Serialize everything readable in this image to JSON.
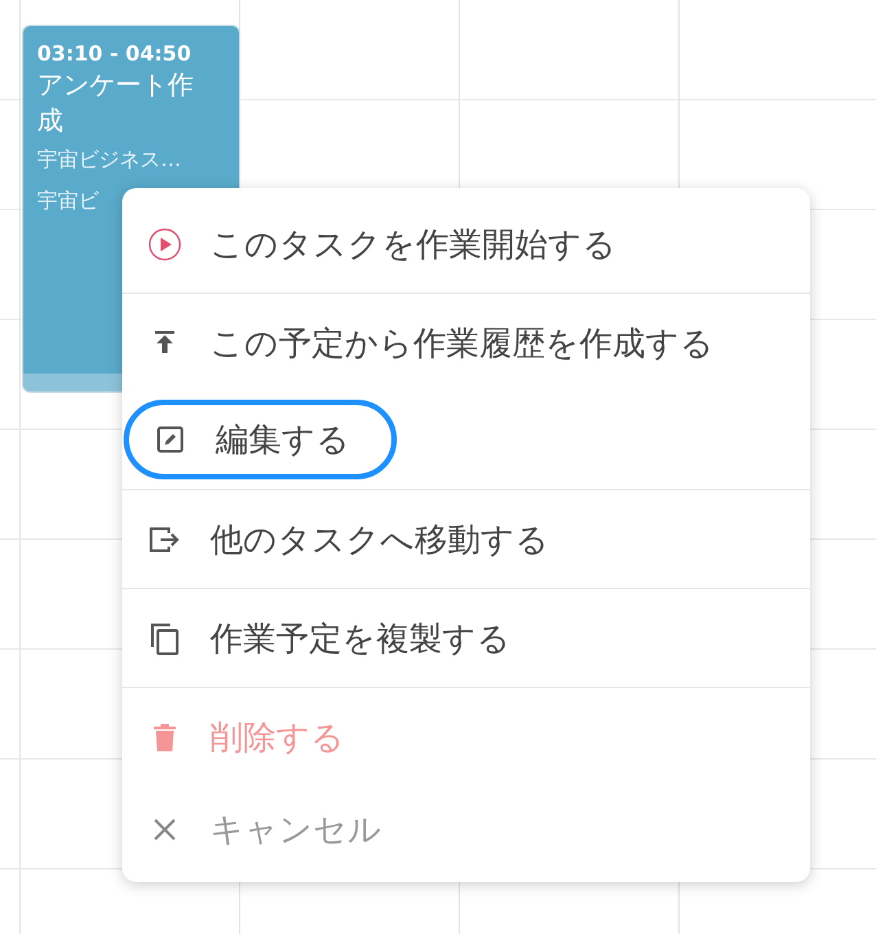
{
  "event": {
    "time": "03:10 - 04:50",
    "title": "アンケート作成",
    "lines": [
      "宇宙ビジネス…",
      "宇宙ビ"
    ]
  },
  "menu": {
    "items": [
      {
        "label": "このタスクを作業開始する",
        "kind": "play",
        "focused": false
      },
      {
        "label": "この予定から作業履歴を作成する",
        "kind": "upload",
        "focused": false
      },
      {
        "label": "編集する",
        "kind": "edit",
        "focused": true
      },
      {
        "label": "他のタスクへ移動する",
        "kind": "move",
        "focused": false
      },
      {
        "label": "作業予定を複製する",
        "kind": "copy",
        "focused": false
      },
      {
        "label": "削除する",
        "kind": "delete",
        "focused": false
      },
      {
        "label": "キャンセル",
        "kind": "cancel",
        "focused": false
      }
    ]
  }
}
